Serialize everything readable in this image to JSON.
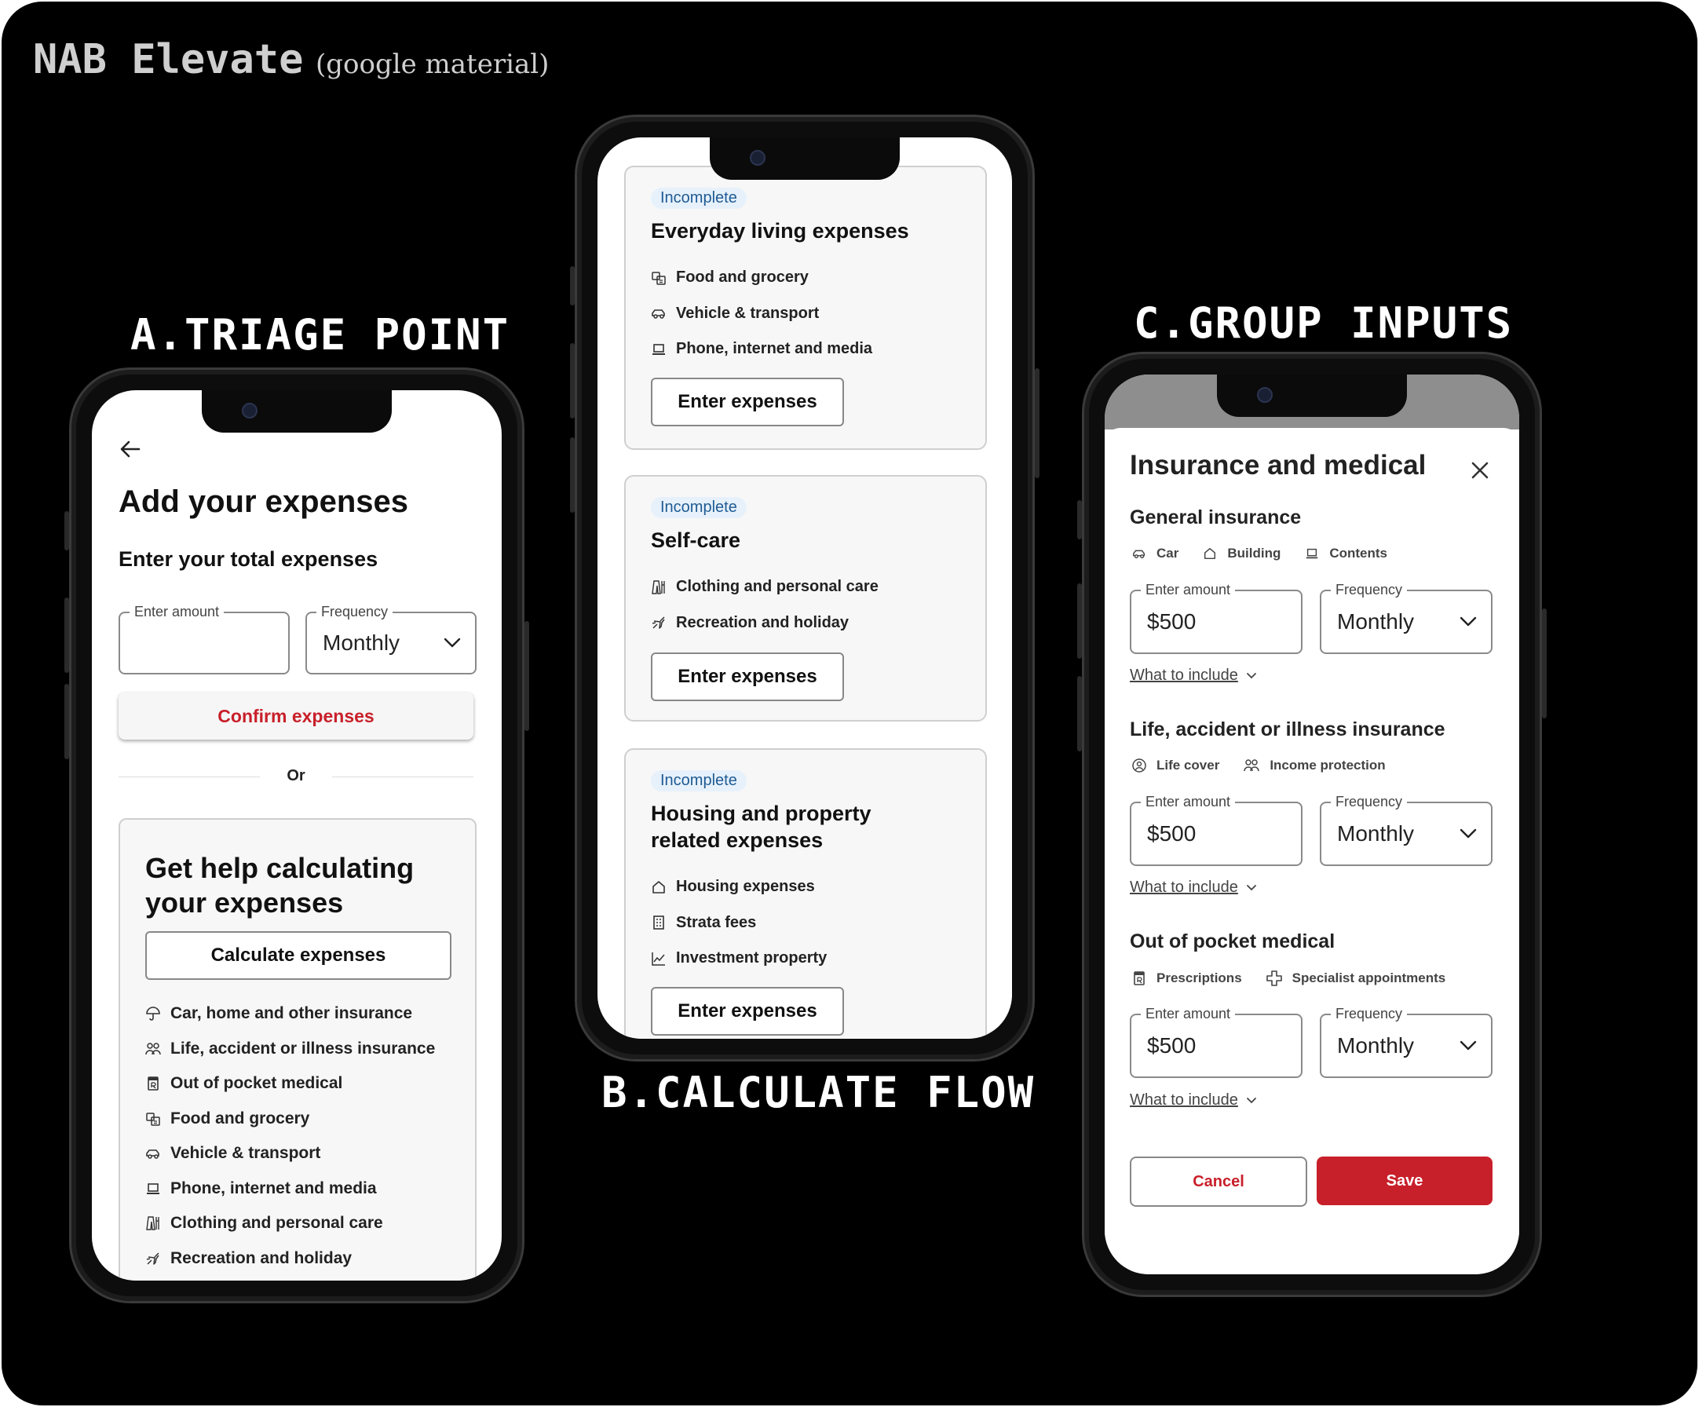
{
  "header": {
    "title": "NAB Elevate",
    "subtitle": "(google material)"
  },
  "sections": {
    "a": "A.TRIAGE POINT",
    "b": "B.CALCULATE FLOW",
    "c": "C.GROUP INPUTS"
  },
  "phone_a": {
    "title": "Add your expenses",
    "subtitle": "Enter your total expenses",
    "amount_label": "Enter amount",
    "amount_value": "",
    "frequency_label": "Frequency",
    "frequency_value": "Monthly",
    "confirm_label": "Confirm expenses",
    "or_label": "Or",
    "help_title": "Get help calculating your expenses",
    "calculate_label": "Calculate expenses",
    "categories": [
      {
        "label": "Car, home and other insurance",
        "icon": "umbrella-icon"
      },
      {
        "label": "Life, accident or illness insurance",
        "icon": "people-icon"
      },
      {
        "label": "Out of pocket medical",
        "icon": "prescription-icon"
      },
      {
        "label": "Food and grocery",
        "icon": "grocery-icon"
      },
      {
        "label": "Vehicle & transport",
        "icon": "car-icon"
      },
      {
        "label": "Phone, internet and media",
        "icon": "laptop-icon"
      },
      {
        "label": "Clothing and personal care",
        "icon": "clothing-icon"
      },
      {
        "label": "Recreation and holiday",
        "icon": "plane-icon"
      }
    ]
  },
  "phone_b": {
    "cards": [
      {
        "badge": "Incomplete",
        "title": "Everyday living expenses",
        "items": [
          {
            "label": "Food and grocery",
            "icon": "grocery-icon"
          },
          {
            "label": "Vehicle & transport",
            "icon": "car-icon"
          },
          {
            "label": "Phone, internet and media",
            "icon": "laptop-icon"
          }
        ],
        "button": "Enter expenses"
      },
      {
        "badge": "Incomplete",
        "title": "Self-care",
        "items": [
          {
            "label": "Clothing and personal care",
            "icon": "clothing-icon"
          },
          {
            "label": "Recreation and holiday",
            "icon": "plane-icon"
          }
        ],
        "button": "Enter expenses"
      },
      {
        "badge": "Incomplete",
        "title": "Housing and property related expenses",
        "items": [
          {
            "label": "Housing expenses",
            "icon": "house-icon"
          },
          {
            "label": "Strata fees",
            "icon": "building-icon"
          },
          {
            "label": "Investment property",
            "icon": "chart-icon"
          }
        ],
        "button": "Enter expenses"
      }
    ]
  },
  "phone_c": {
    "title": "Insurance and medical",
    "sections": [
      {
        "title": "General insurance",
        "chips": [
          {
            "label": "Car",
            "icon": "car-icon"
          },
          {
            "label": "Building",
            "icon": "house-icon"
          },
          {
            "label": "Contents",
            "icon": "laptop-icon"
          }
        ],
        "amount_label": "Enter amount",
        "amount_value": "$500",
        "frequency_label": "Frequency",
        "frequency_value": "Monthly",
        "what_to_include": "What to include"
      },
      {
        "title": "Life, accident or illness insurance",
        "chips": [
          {
            "label": "Life cover",
            "icon": "person-circle-icon"
          },
          {
            "label": "Income protection",
            "icon": "people-icon"
          }
        ],
        "amount_label": "Enter amount",
        "amount_value": "$500",
        "frequency_label": "Frequency",
        "frequency_value": "Monthly",
        "what_to_include": "What to include"
      },
      {
        "title": "Out of pocket medical",
        "chips": [
          {
            "label": "Prescriptions",
            "icon": "prescription-icon"
          },
          {
            "label": "Specialist appointments",
            "icon": "medical-cross-icon"
          }
        ],
        "amount_label": "Enter amount",
        "amount_value": "$500",
        "frequency_label": "Frequency",
        "frequency_value": "Monthly",
        "what_to_include": "What to include"
      }
    ],
    "cancel_label": "Cancel",
    "save_label": "Save"
  },
  "colors": {
    "accent_red": "#c8202a",
    "badge_bg": "#e7f1fb",
    "badge_text": "#1f5b93",
    "canvas": "#000000"
  }
}
